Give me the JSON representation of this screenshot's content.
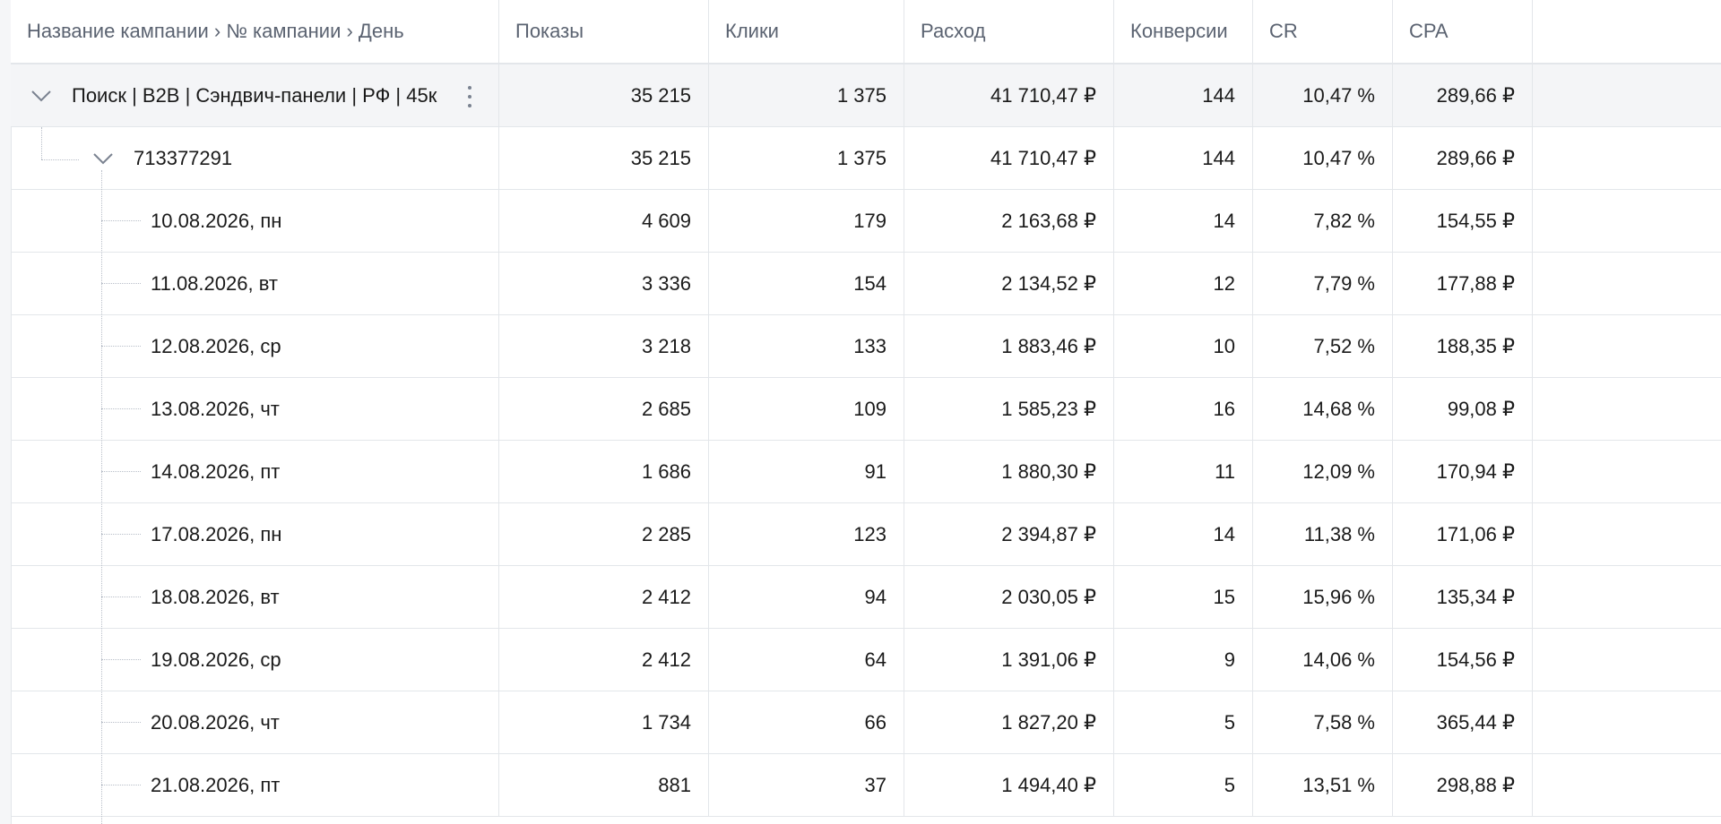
{
  "table": {
    "headers": [
      "Название кампании › № кампании › День",
      "Показы",
      "Клики",
      "Расход",
      "Конверсии",
      "CR",
      "CPA",
      ""
    ],
    "campaign": {
      "name": "Поиск | B2B | Сэндвич-панели | РФ | 45к",
      "impressions": "35 215",
      "clicks": "1 375",
      "cost": "41 710,47 ₽",
      "conversions": "144",
      "cr": "10,47 %",
      "cpa": "289,66 ₽"
    },
    "campaign_id_row": {
      "id": "713377291",
      "impressions": "35 215",
      "clicks": "1 375",
      "cost": "41 710,47 ₽",
      "conversions": "144",
      "cr": "10,47 %",
      "cpa": "289,66 ₽"
    },
    "days": [
      {
        "date": "10.08.2026, пн",
        "impressions": "4 609",
        "clicks": "179",
        "cost": "2 163,68 ₽",
        "conversions": "14",
        "cr": "7,82 %",
        "cpa": "154,55 ₽"
      },
      {
        "date": "11.08.2026, вт",
        "impressions": "3 336",
        "clicks": "154",
        "cost": "2 134,52 ₽",
        "conversions": "12",
        "cr": "7,79 %",
        "cpa": "177,88 ₽"
      },
      {
        "date": "12.08.2026, ср",
        "impressions": "3 218",
        "clicks": "133",
        "cost": "1 883,46 ₽",
        "conversions": "10",
        "cr": "7,52 %",
        "cpa": "188,35 ₽"
      },
      {
        "date": "13.08.2026, чт",
        "impressions": "2 685",
        "clicks": "109",
        "cost": "1 585,23 ₽",
        "conversions": "16",
        "cr": "14,68 %",
        "cpa": "99,08 ₽"
      },
      {
        "date": "14.08.2026, пт",
        "impressions": "1 686",
        "clicks": "91",
        "cost": "1 880,30 ₽",
        "conversions": "11",
        "cr": "12,09 %",
        "cpa": "170,94 ₽"
      },
      {
        "date": "17.08.2026, пн",
        "impressions": "2 285",
        "clicks": "123",
        "cost": "2 394,87 ₽",
        "conversions": "14",
        "cr": "11,38 %",
        "cpa": "171,06 ₽"
      },
      {
        "date": "18.08.2026, вт",
        "impressions": "2 412",
        "clicks": "94",
        "cost": "2 030,05 ₽",
        "conversions": "15",
        "cr": "15,96 %",
        "cpa": "135,34 ₽"
      },
      {
        "date": "19.08.2026, ср",
        "impressions": "2 412",
        "clicks": "64",
        "cost": "1 391,06 ₽",
        "conversions": "9",
        "cr": "14,06 %",
        "cpa": "154,56 ₽"
      },
      {
        "date": "20.08.2026, чт",
        "impressions": "1 734",
        "clicks": "66",
        "cost": "1 827,20 ₽",
        "conversions": "5",
        "cr": "7,58 %",
        "cpa": "365,44 ₽"
      },
      {
        "date": "21.08.2026, пт",
        "impressions": "881",
        "clicks": "37",
        "cost": "1 494,40 ₽",
        "conversions": "5",
        "cr": "13,51 %",
        "cpa": "298,88 ₽"
      }
    ]
  },
  "icons": {
    "expand": "chevron-down-icon",
    "more": "kebab-menu-icon"
  },
  "colors": {
    "header_text": "#5b6371",
    "grid": "#e3e6ea",
    "group_bg": "#f4f5f7"
  }
}
